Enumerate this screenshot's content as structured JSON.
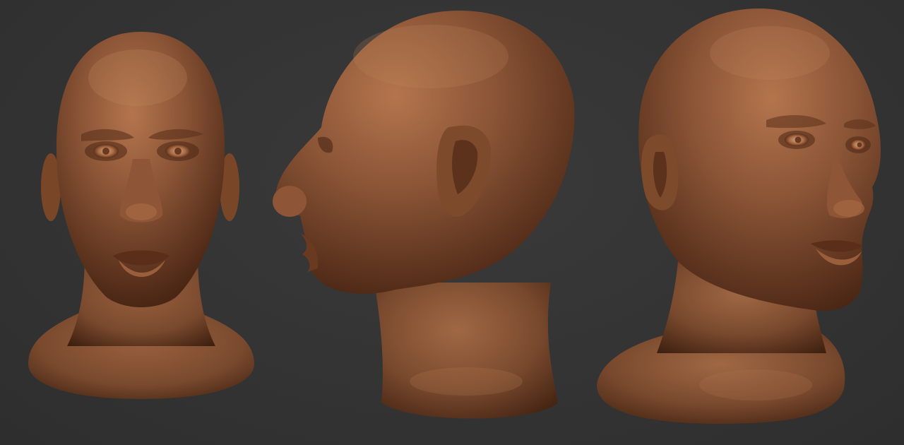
{
  "scene": {
    "background_color": "#353535",
    "material_color": "#8a5436",
    "material_highlight": "#c0825a",
    "material_shadow": "#3a1d10",
    "views": [
      {
        "id": "front",
        "icon": "sculpt-head-front-view"
      },
      {
        "id": "side",
        "icon": "sculpt-head-side-view"
      },
      {
        "id": "three-quarter",
        "icon": "sculpt-head-three-quarter-view"
      }
    ]
  }
}
